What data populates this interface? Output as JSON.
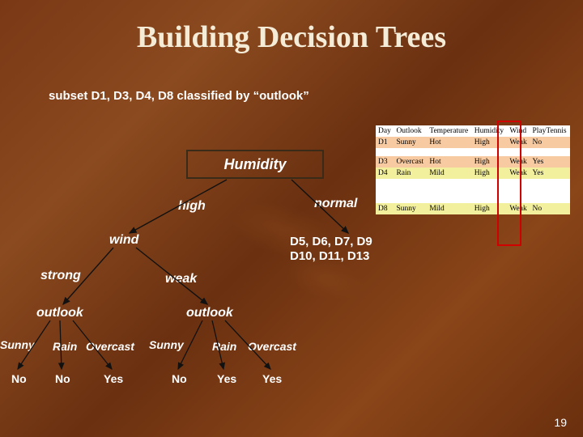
{
  "title": "Building Decision Trees",
  "subtitle": "subset D1, D3, D4, D8 classified by  “outlook”",
  "tree": {
    "root": "Humidity",
    "branch_high": "high",
    "branch_normal": "normal",
    "normal_leaf_l1": "D5, D6, D7, D9",
    "normal_leaf_l2": "D10, D11, D13",
    "wind": "wind",
    "strong": "strong",
    "weak": "weak",
    "outlook_l": "outlook",
    "outlook_r": "outlook",
    "l_sunny": "Sunny",
    "l_rain": "Rain",
    "l_overcast": "Overcast",
    "r_sunny": "Sunny",
    "r_rain": "Rain",
    "r_overcast": "Overcast",
    "l_sunny_leaf": "No",
    "l_rain_leaf": "No",
    "l_overcast_leaf": "Yes",
    "r_sunny_leaf": "No",
    "r_rain_leaf": "Yes",
    "r_overcast_leaf": "Yes"
  },
  "table": {
    "headers": [
      "Day",
      "Outlook",
      "Temperature",
      "Humidity",
      "Wind",
      "PlayTennis"
    ],
    "rows": [
      {
        "cells": [
          "D1",
          "Sunny",
          "Hot",
          "High",
          "Weak",
          "No"
        ],
        "stripe": "peach"
      },
      {
        "blank": true
      },
      {
        "cells": [
          "D3",
          "Overcast",
          "Hot",
          "High",
          "Weak",
          "Yes"
        ],
        "stripe": "peach"
      },
      {
        "cells": [
          "D4",
          "Rain",
          "Mild",
          "High",
          "Weak",
          "Yes"
        ],
        "stripe": "yellow"
      },
      {
        "blank": true
      },
      {
        "blank": true
      },
      {
        "blank": true
      },
      {
        "cells": [
          "D8",
          "Sunny",
          "Mild",
          "High",
          "Weak",
          "No"
        ],
        "stripe": "yellow"
      }
    ]
  },
  "page_number": "19"
}
